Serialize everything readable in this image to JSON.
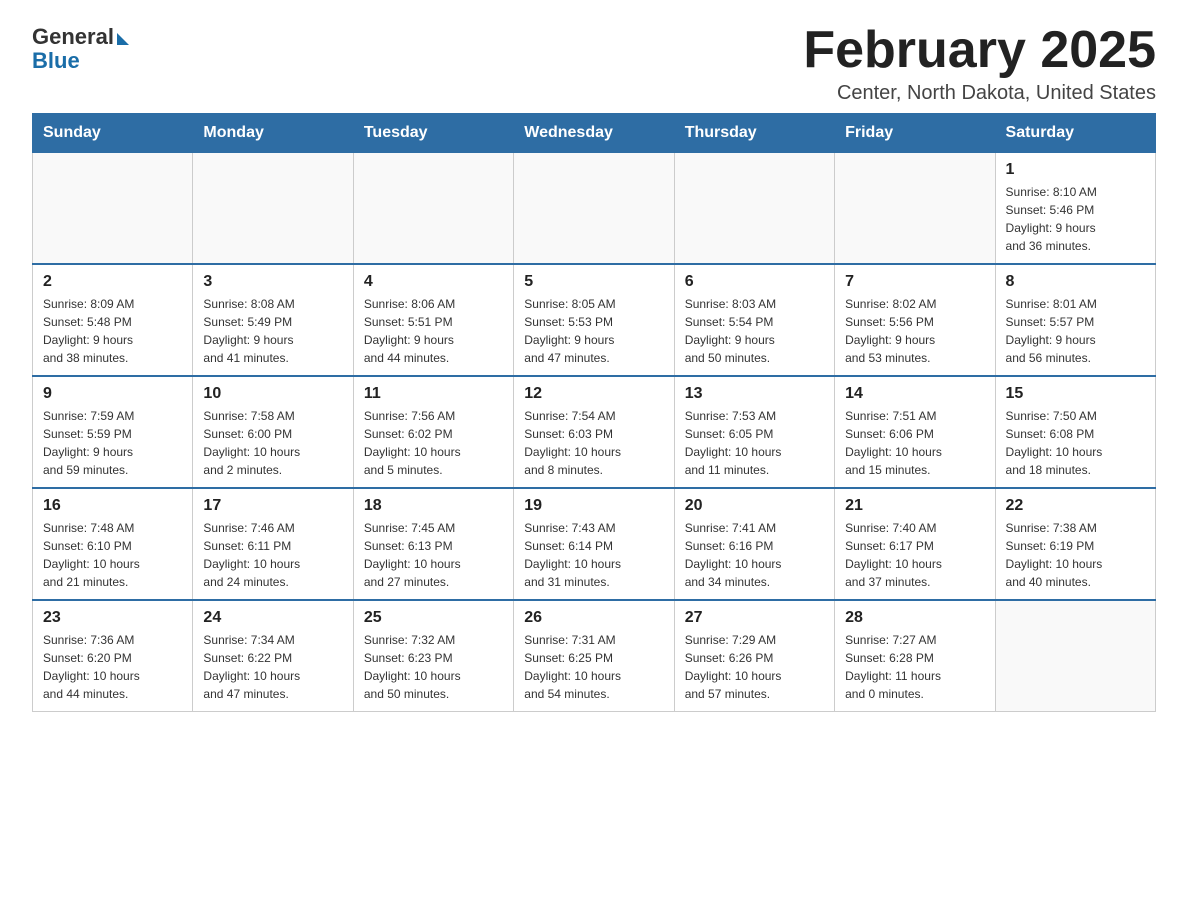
{
  "header": {
    "logo_general": "General",
    "logo_blue": "Blue",
    "month_title": "February 2025",
    "location": "Center, North Dakota, United States"
  },
  "weekdays": [
    "Sunday",
    "Monday",
    "Tuesday",
    "Wednesday",
    "Thursday",
    "Friday",
    "Saturday"
  ],
  "weeks": [
    [
      {
        "day": "",
        "info": ""
      },
      {
        "day": "",
        "info": ""
      },
      {
        "day": "",
        "info": ""
      },
      {
        "day": "",
        "info": ""
      },
      {
        "day": "",
        "info": ""
      },
      {
        "day": "",
        "info": ""
      },
      {
        "day": "1",
        "info": "Sunrise: 8:10 AM\nSunset: 5:46 PM\nDaylight: 9 hours\nand 36 minutes."
      }
    ],
    [
      {
        "day": "2",
        "info": "Sunrise: 8:09 AM\nSunset: 5:48 PM\nDaylight: 9 hours\nand 38 minutes."
      },
      {
        "day": "3",
        "info": "Sunrise: 8:08 AM\nSunset: 5:49 PM\nDaylight: 9 hours\nand 41 minutes."
      },
      {
        "day": "4",
        "info": "Sunrise: 8:06 AM\nSunset: 5:51 PM\nDaylight: 9 hours\nand 44 minutes."
      },
      {
        "day": "5",
        "info": "Sunrise: 8:05 AM\nSunset: 5:53 PM\nDaylight: 9 hours\nand 47 minutes."
      },
      {
        "day": "6",
        "info": "Sunrise: 8:03 AM\nSunset: 5:54 PM\nDaylight: 9 hours\nand 50 minutes."
      },
      {
        "day": "7",
        "info": "Sunrise: 8:02 AM\nSunset: 5:56 PM\nDaylight: 9 hours\nand 53 minutes."
      },
      {
        "day": "8",
        "info": "Sunrise: 8:01 AM\nSunset: 5:57 PM\nDaylight: 9 hours\nand 56 minutes."
      }
    ],
    [
      {
        "day": "9",
        "info": "Sunrise: 7:59 AM\nSunset: 5:59 PM\nDaylight: 9 hours\nand 59 minutes."
      },
      {
        "day": "10",
        "info": "Sunrise: 7:58 AM\nSunset: 6:00 PM\nDaylight: 10 hours\nand 2 minutes."
      },
      {
        "day": "11",
        "info": "Sunrise: 7:56 AM\nSunset: 6:02 PM\nDaylight: 10 hours\nand 5 minutes."
      },
      {
        "day": "12",
        "info": "Sunrise: 7:54 AM\nSunset: 6:03 PM\nDaylight: 10 hours\nand 8 minutes."
      },
      {
        "day": "13",
        "info": "Sunrise: 7:53 AM\nSunset: 6:05 PM\nDaylight: 10 hours\nand 11 minutes."
      },
      {
        "day": "14",
        "info": "Sunrise: 7:51 AM\nSunset: 6:06 PM\nDaylight: 10 hours\nand 15 minutes."
      },
      {
        "day": "15",
        "info": "Sunrise: 7:50 AM\nSunset: 6:08 PM\nDaylight: 10 hours\nand 18 minutes."
      }
    ],
    [
      {
        "day": "16",
        "info": "Sunrise: 7:48 AM\nSunset: 6:10 PM\nDaylight: 10 hours\nand 21 minutes."
      },
      {
        "day": "17",
        "info": "Sunrise: 7:46 AM\nSunset: 6:11 PM\nDaylight: 10 hours\nand 24 minutes."
      },
      {
        "day": "18",
        "info": "Sunrise: 7:45 AM\nSunset: 6:13 PM\nDaylight: 10 hours\nand 27 minutes."
      },
      {
        "day": "19",
        "info": "Sunrise: 7:43 AM\nSunset: 6:14 PM\nDaylight: 10 hours\nand 31 minutes."
      },
      {
        "day": "20",
        "info": "Sunrise: 7:41 AM\nSunset: 6:16 PM\nDaylight: 10 hours\nand 34 minutes."
      },
      {
        "day": "21",
        "info": "Sunrise: 7:40 AM\nSunset: 6:17 PM\nDaylight: 10 hours\nand 37 minutes."
      },
      {
        "day": "22",
        "info": "Sunrise: 7:38 AM\nSunset: 6:19 PM\nDaylight: 10 hours\nand 40 minutes."
      }
    ],
    [
      {
        "day": "23",
        "info": "Sunrise: 7:36 AM\nSunset: 6:20 PM\nDaylight: 10 hours\nand 44 minutes."
      },
      {
        "day": "24",
        "info": "Sunrise: 7:34 AM\nSunset: 6:22 PM\nDaylight: 10 hours\nand 47 minutes."
      },
      {
        "day": "25",
        "info": "Sunrise: 7:32 AM\nSunset: 6:23 PM\nDaylight: 10 hours\nand 50 minutes."
      },
      {
        "day": "26",
        "info": "Sunrise: 7:31 AM\nSunset: 6:25 PM\nDaylight: 10 hours\nand 54 minutes."
      },
      {
        "day": "27",
        "info": "Sunrise: 7:29 AM\nSunset: 6:26 PM\nDaylight: 10 hours\nand 57 minutes."
      },
      {
        "day": "28",
        "info": "Sunrise: 7:27 AM\nSunset: 6:28 PM\nDaylight: 11 hours\nand 0 minutes."
      },
      {
        "day": "",
        "info": ""
      }
    ]
  ]
}
